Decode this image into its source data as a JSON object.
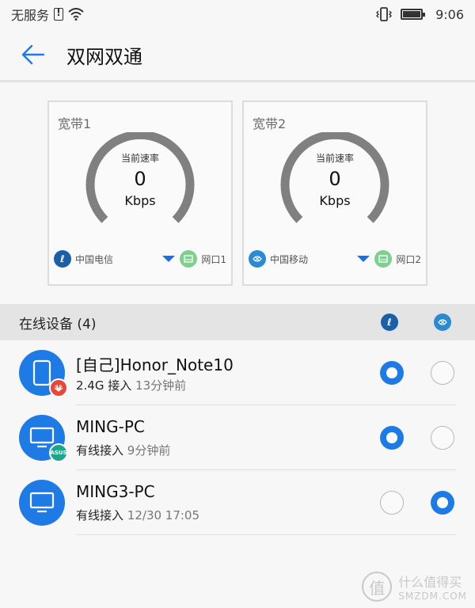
{
  "statusbar": {
    "network": "无服务",
    "time": "9:06"
  },
  "header": {
    "title": "双网双通"
  },
  "broadband": [
    {
      "label": "宽带1",
      "caption": "当前速率",
      "speed": "0",
      "unit": "Kbps",
      "operator": "中国电信",
      "port": "网口1"
    },
    {
      "label": "宽带2",
      "caption": "当前速率",
      "speed": "0",
      "unit": "Kbps",
      "operator": "中国移动",
      "port": "网口2"
    }
  ],
  "devices_section": {
    "title": "在线设备 (4)"
  },
  "devices": [
    {
      "name": "[自己]Honor_Note10",
      "conn": "2.4G 接入",
      "time": "13分钟前",
      "badge": "",
      "line": 1
    },
    {
      "name": "MING-PC",
      "conn": "有线接入",
      "time": "9分钟前",
      "badge": "ASUS",
      "line": 1
    },
    {
      "name": "MING3-PC",
      "conn": "有线接入",
      "time": "12/30 17:05",
      "badge": "",
      "line": 2
    }
  ],
  "watermark": {
    "line1": "什么值得买",
    "line2": "SMZDM.COM"
  },
  "colors": {
    "accent": "#1e7be6",
    "gauge": "#808080",
    "telecom": "#1b5fa8",
    "mobile": "#2a8bd0",
    "port": "#7fd08f"
  }
}
